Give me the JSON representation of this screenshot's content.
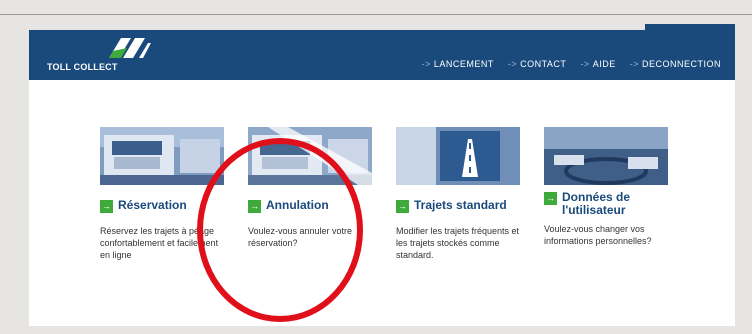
{
  "brand": {
    "logo_text": "TOLL COLLECT"
  },
  "nav": [
    {
      "label": "LANCEMENT"
    },
    {
      "label": "CONTACT"
    },
    {
      "label": "AIDE"
    },
    {
      "label": "DECONNECTION"
    }
  ],
  "nav_arrow": "->",
  "cards": [
    {
      "title": "Réservation",
      "desc": "Réservez les trajets à péage confortablement et facilement en ligne"
    },
    {
      "title": "Annulation",
      "desc": "Voulez-vous annuler votre réservation?"
    },
    {
      "title": "Trajets standard",
      "desc": "Modifier les trajets fréquents et les trajets stockés comme standard."
    },
    {
      "title": "Données de l'utilisateur",
      "desc": "Voulez-vous changer vos informations personnelles?"
    }
  ],
  "colors": {
    "header": "#1a4a7c",
    "go_button": "#3daa3a",
    "highlight_circle": "#e0101a"
  }
}
